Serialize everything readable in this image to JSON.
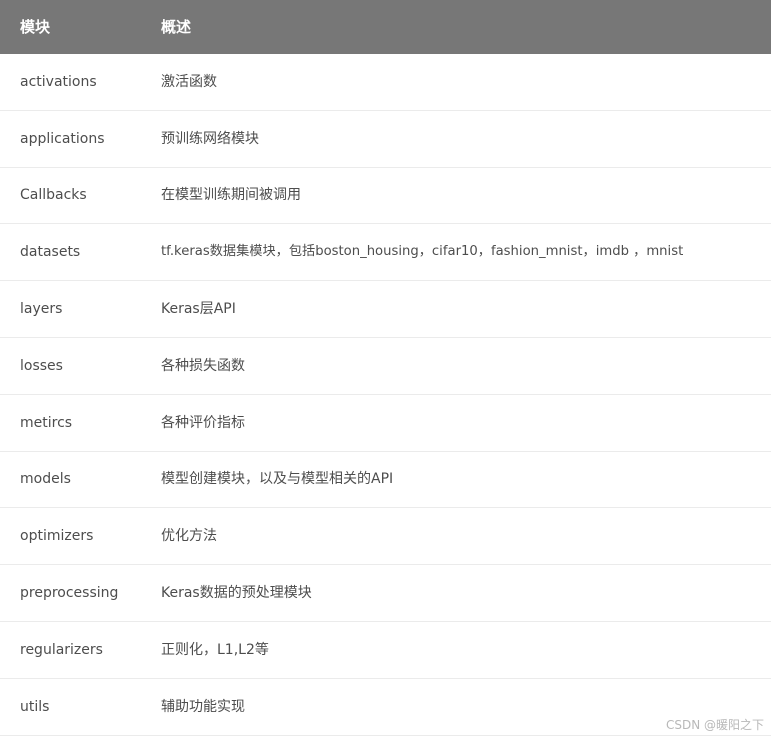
{
  "table": {
    "headers": [
      "模块",
      "概述"
    ],
    "rows": [
      {
        "module": "activations",
        "desc": "激活函数"
      },
      {
        "module": "applications",
        "desc": "预训练网络模块"
      },
      {
        "module": "Callbacks",
        "desc": "在模型训练期间被调用"
      },
      {
        "module": "datasets",
        "desc": "tf.keras数据集模块，包括boston_housing，cifar10，fashion_mnist，imdb ，mnist"
      },
      {
        "module": "layers",
        "desc": "Keras层API"
      },
      {
        "module": "losses",
        "desc": "各种损失函数"
      },
      {
        "module": "metircs",
        "desc": "各种评价指标"
      },
      {
        "module": "models",
        "desc": "模型创建模块，以及与模型相关的API"
      },
      {
        "module": "optimizers",
        "desc": "优化方法"
      },
      {
        "module": "preprocessing",
        "desc": "Keras数据的预处理模块"
      },
      {
        "module": "regularizers",
        "desc": "正则化，L1,L2等"
      },
      {
        "module": "utils",
        "desc": "辅助功能实现"
      }
    ]
  },
  "watermark": "CSDN @暖阳之下",
  "colors": {
    "header_bg": "#777777",
    "header_text": "#ffffff",
    "body_text": "#4d4d4d",
    "row_border": "#ebebeb"
  }
}
